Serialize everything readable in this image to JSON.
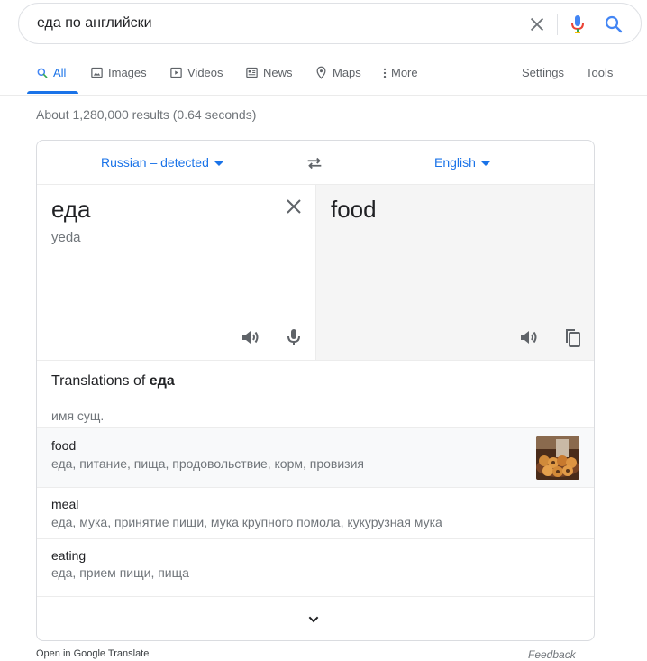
{
  "search": {
    "query": "еда по английски"
  },
  "tabs": {
    "all": "All",
    "images": "Images",
    "videos": "Videos",
    "news": "News",
    "maps": "Maps",
    "more": "More",
    "settings": "Settings",
    "tools": "Tools"
  },
  "results_stats": "About 1,280,000 results (0.64 seconds)",
  "translate": {
    "source_lang": "Russian – detected",
    "target_lang": "English",
    "source_text": "еда",
    "transliteration": "yeda",
    "target_text": "food",
    "translations_of_prefix": "Translations of",
    "translations_of_word": "еда",
    "part_of_speech": "имя сущ.",
    "entries": [
      {
        "word": "food",
        "synonyms": "еда, питание, пища, продовольствие, корм, провизия"
      },
      {
        "word": "meal",
        "synonyms": "еда, мука, принятие пищи, мука крупного помола, кукурузная мука"
      },
      {
        "word": "eating",
        "synonyms": "еда, прием пищи, пища"
      }
    ]
  },
  "footer": {
    "open_link": "Open in Google Translate",
    "feedback": "Feedback"
  },
  "colors": {
    "accent": "#1a73e8",
    "muted": "#70757a",
    "text": "#202124",
    "pane_bg": "#f5f5f5",
    "border": "#dadce0"
  },
  "icons": [
    "clear-icon",
    "microphone-icon",
    "search-icon",
    "image-icon",
    "video-icon",
    "news-icon",
    "map-pin-icon",
    "more-vert-icon",
    "swap-icon",
    "speaker-icon",
    "copy-icon",
    "chevron-down-icon"
  ]
}
